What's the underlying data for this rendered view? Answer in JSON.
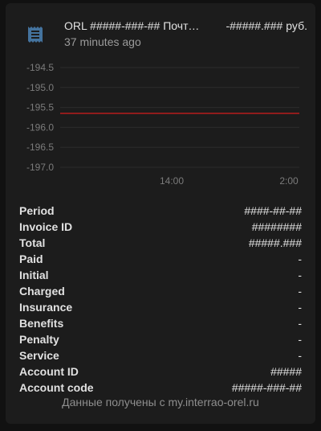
{
  "header": {
    "icon": "receipt-icon",
    "title": "ORL #####-###-## Почтовая",
    "time": "37 minutes ago",
    "state": "-#####.###",
    "unit": "руб."
  },
  "chart_data": {
    "type": "line",
    "title": "",
    "xlabel": "",
    "ylabel": "",
    "x_ticks": [
      "14:00",
      "2:00"
    ],
    "y_ticks": [
      "-194.5",
      "-195.0",
      "-195.5",
      "-196.0",
      "-196.5",
      "-197.0"
    ],
    "ylim": [
      -197.0,
      -194.5
    ],
    "grid": true,
    "legend": "none",
    "series": [
      {
        "color": "#b71c1c",
        "x": [
          0,
          1
        ],
        "y": [
          -195.65,
          -195.65
        ]
      }
    ]
  },
  "attributes": [
    {
      "label": "Period",
      "value": "####-##-##"
    },
    {
      "label": "Invoice ID",
      "value": "########"
    },
    {
      "label": "Total",
      "value": "#####.###"
    },
    {
      "label": "Paid",
      "value": "-"
    },
    {
      "label": "Initial",
      "value": "-"
    },
    {
      "label": "Charged",
      "value": "-"
    },
    {
      "label": "Insurance",
      "value": "-"
    },
    {
      "label": "Benefits",
      "value": "-"
    },
    {
      "label": "Penalty",
      "value": "-"
    },
    {
      "label": "Service",
      "value": "-"
    },
    {
      "label": "Account ID",
      "value": "#####"
    },
    {
      "label": "Account code",
      "value": "#####-###-##"
    }
  ],
  "footer": "Данные получены с my.interrao-orel.ru",
  "colors": {
    "card_bg": "#1c1c1c",
    "series_line": "#b71c1c",
    "text_primary": "#e1e1e1",
    "text_secondary": "#9b9b9b"
  }
}
